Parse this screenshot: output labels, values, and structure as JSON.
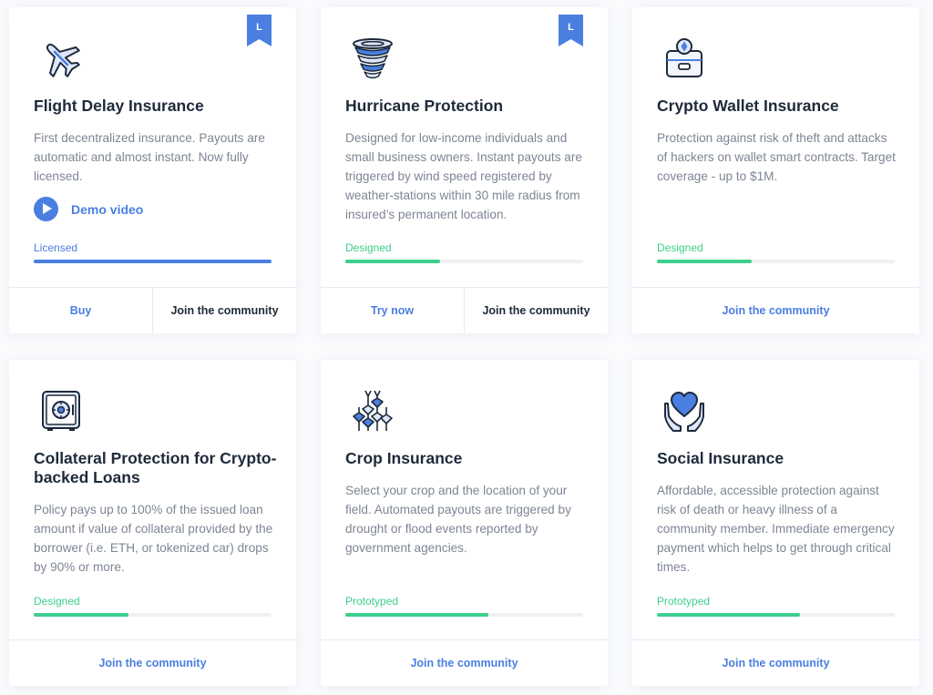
{
  "colors": {
    "accent": "#4a7fe1",
    "green": "#3ecf8e",
    "title": "#1e2a3b",
    "text": "#7d8594",
    "track": "#eef0f4"
  },
  "cards": [
    {
      "icon": "airplane-icon",
      "badge": "L",
      "title": "Flight Delay Insurance",
      "description": "First decentralized insurance. Payouts are automatic and almost instant. Now fully licensed.",
      "demo_label": "Demo video",
      "status": "Licensed",
      "status_color": "#4a7fe1",
      "progress": 1.0,
      "actions": [
        "Buy",
        "Join the community"
      ]
    },
    {
      "icon": "tornado-icon",
      "badge": "L",
      "title": "Hurricane Protection",
      "description": "Designed for low-income individuals and small business owners. Instant payouts are triggered by wind speed registered by weather-stations within 30 mile radius from insured’s permanent location.",
      "status": "Designed",
      "status_color": "#3ecf8e",
      "progress": 0.4,
      "actions": [
        "Try now",
        "Join the community"
      ]
    },
    {
      "icon": "crypto-wallet-icon",
      "title": "Crypto Wallet Insurance",
      "description": "Protection against risk of theft and attacks of hackers on wallet smart contracts. Target coverage - up to $1M.",
      "status": "Designed",
      "status_color": "#3ecf8e",
      "progress": 0.4,
      "actions": [
        "Join the community"
      ]
    },
    {
      "icon": "safe-icon",
      "title": "Collateral Protection for Crypto-backed Loans",
      "description": "Policy pays up to 100% of the issued loan amount if value of collateral provided by the borrower (i.e. ETH, or tokenized car) drops by 90% or more.",
      "status": "Designed",
      "status_color": "#3ecf8e",
      "progress": 0.4,
      "actions": [
        "Join the community"
      ]
    },
    {
      "icon": "wheat-icon",
      "title": "Crop Insurance",
      "description": "Select your crop and the location of your field. Automated payouts are triggered by drought or flood events reported by government agencies.",
      "status": "Prototyped",
      "status_color": "#3ecf8e",
      "progress": 0.6,
      "actions": [
        "Join the community"
      ]
    },
    {
      "icon": "heart-hands-icon",
      "title": "Social Insurance",
      "description": "Affordable, accessible protection against risk of death or heavy illness of a community member. Immediate emergency payment which helps to get through critical times.",
      "status": "Prototyped",
      "status_color": "#3ecf8e",
      "progress": 0.6,
      "actions": [
        "Join the community"
      ]
    }
  ]
}
